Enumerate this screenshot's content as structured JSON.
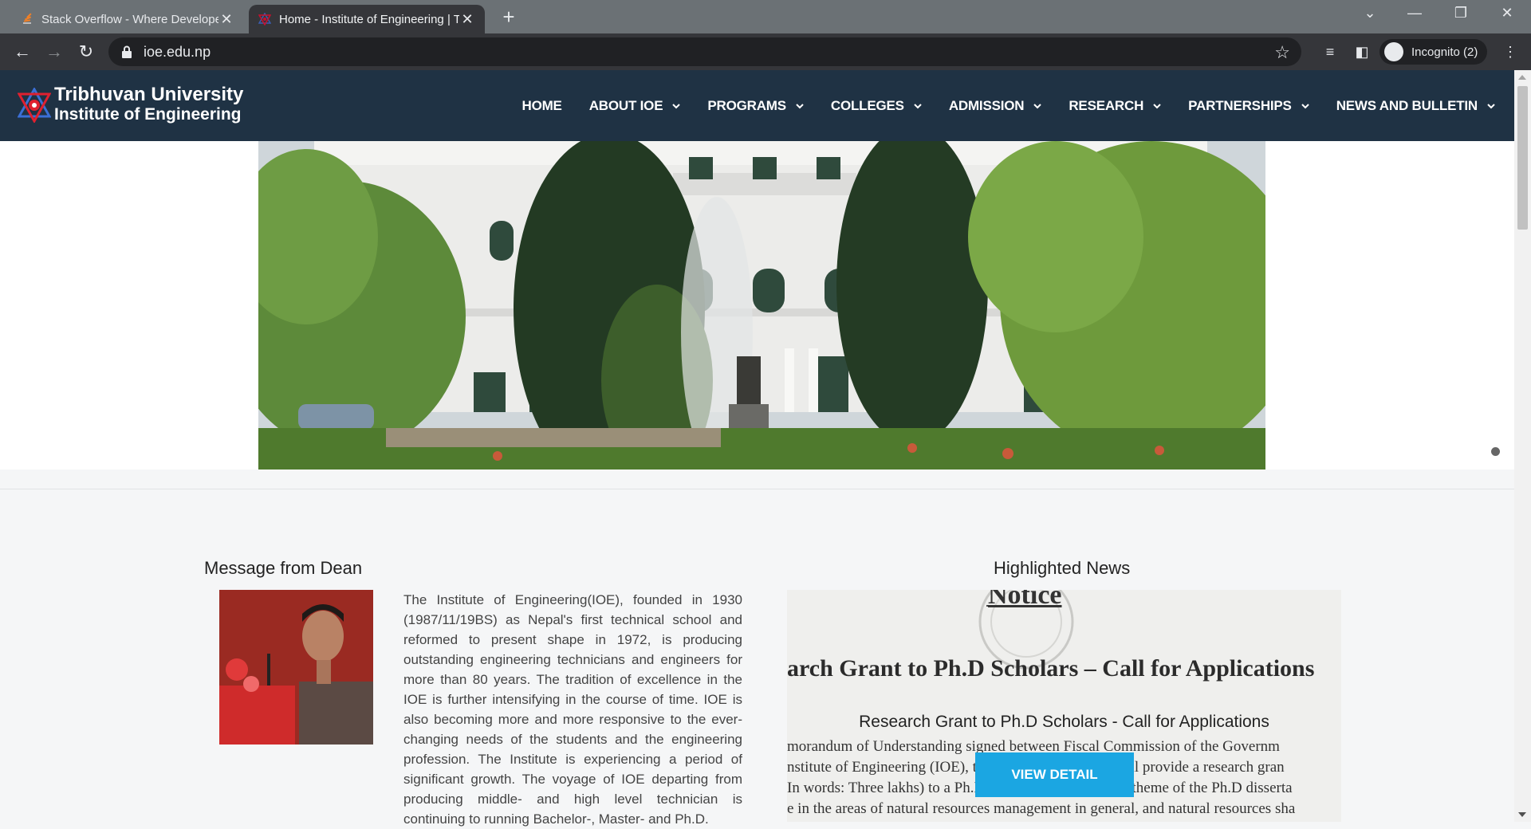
{
  "browser": {
    "tabs": [
      {
        "title": "Stack Overflow - Where Developers Learn",
        "active": false
      },
      {
        "title": "Home - Institute of Engineering | Tribhuvan",
        "active": true
      }
    ],
    "new_tab_label": "+",
    "url": "ioe.edu.np",
    "profile_label": "Incognito (2)"
  },
  "site": {
    "brand_line1": "Tribhuvan University",
    "brand_line2": "Institute of Engineering",
    "nav": [
      {
        "label": "HOME",
        "has_dropdown": false
      },
      {
        "label": "ABOUT IOE",
        "has_dropdown": true
      },
      {
        "label": "PROGRAMS",
        "has_dropdown": true
      },
      {
        "label": "COLLEGES",
        "has_dropdown": true
      },
      {
        "label": "ADMISSION",
        "has_dropdown": true
      },
      {
        "label": "RESEARCH",
        "has_dropdown": true
      },
      {
        "label": "PARTNERSHIPS",
        "has_dropdown": true
      },
      {
        "label": "NEWS AND BULLETIN",
        "has_dropdown": true
      }
    ]
  },
  "dean": {
    "heading": "Message from Dean",
    "message": "The Institute of Engineering(IOE), founded in 1930 (1987/11/19BS) as Nepal's first technical school and reformed to present shape  in 1972,  is producing outstanding engineering technicians and engineers for more than 80 years. The tradition of excellence  in the IOE is further intensifying in the course of time. IOE is also becoming  more and more responsive to the ever-changing needs of the students and the  engineering profession.   The Institute is experiencing a period of significant  growth. The voyage of IOE departing from producing middle- and high level  technician is continuing to running Bachelor-, Master- and Ph.D."
  },
  "news": {
    "heading": "Highlighted News",
    "notice_word": "Notice",
    "notice_headline": "arch Grant to Ph.D Scholars – Call for Applications",
    "notice_lines": [
      "morandum of Understanding signed between Fiscal Commission of the Governm",
      "nstitute of Engineering (IOE), the Fiscal Commission will provide a research gran",
      "In words: Three lakhs) to a Ph.D Scholar from IOE. The theme of the Ph.D disserta",
      "e in the areas of natural resources management in general, and natural resources sha"
    ],
    "caption": "Research Grant to Ph.D Scholars - Call for Applications",
    "button_label": "VIEW DETAIL"
  },
  "colors": {
    "header_bg": "#1f3244",
    "button_bg": "#1ba6e2",
    "tabbar_bg": "#6b7175",
    "toolbar_bg": "#35363a"
  }
}
